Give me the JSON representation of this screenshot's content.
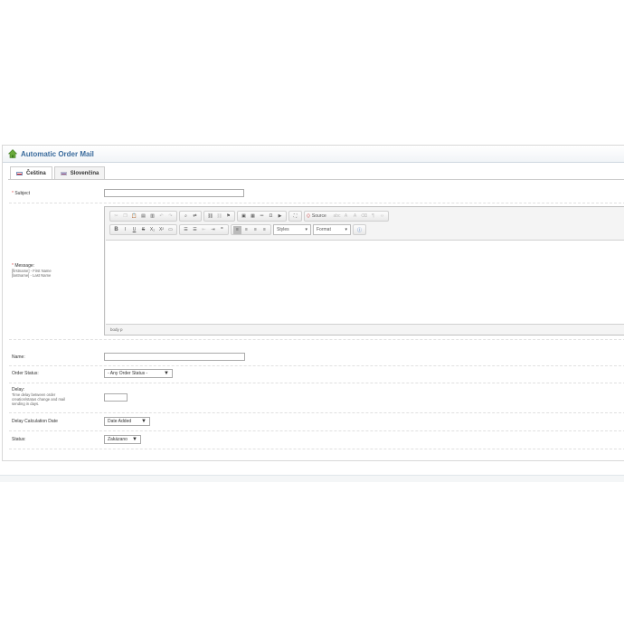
{
  "panel": {
    "title": "Automatic Order Mail",
    "home_icon": "home-icon"
  },
  "tabs": [
    {
      "label": "Čeština",
      "flag": "flag-cz",
      "active": true
    },
    {
      "label": "Slovenčina",
      "flag": "flag-sk",
      "active": false
    }
  ],
  "form": {
    "subject": {
      "label": "Subject",
      "required": "*",
      "value": ""
    },
    "message": {
      "label": "Message:",
      "required": "*",
      "hint1": "[firstname] - First Name",
      "hint2": "[lastname] - Last Name"
    },
    "name": {
      "label": "Name:",
      "value": ""
    },
    "order_status": {
      "label": "Order Status:",
      "selected": "- Any Order Status -"
    },
    "delay": {
      "label": "Delay:",
      "hint1": "Time delay between order",
      "hint2": "creation/status change and mail",
      "hint3": "sending in days.",
      "value": ""
    },
    "delay_calc": {
      "label": "Delay Calculation Date",
      "selected": "Date Added"
    },
    "status": {
      "label": "Status:",
      "selected": "Zakázano"
    }
  },
  "editor": {
    "source_label": "Source",
    "styles_label": "Styles",
    "format_label": "Format",
    "path": "body  p",
    "toolbar_row2": [
      "B",
      "I",
      "U",
      "S",
      "X₂",
      "X²"
    ]
  },
  "colors": {
    "title": "#3a6b9c",
    "required": "#e05050"
  }
}
